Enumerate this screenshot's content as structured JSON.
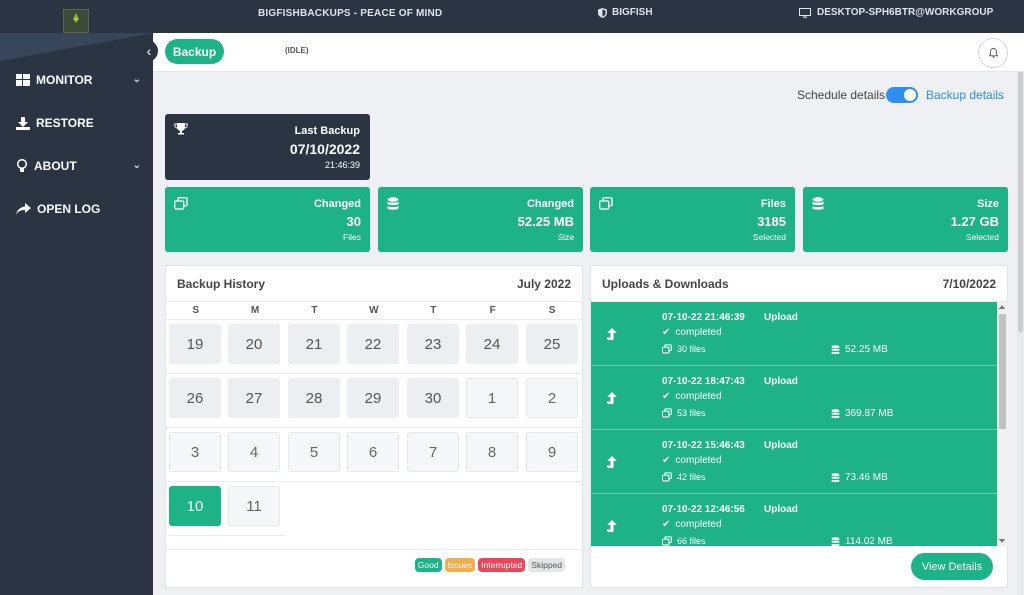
{
  "topbar": {
    "logo_text": "BigFish",
    "app_title": "BIGFISHBACKUPS - PEACE OF MIND",
    "org": "BIGFISH",
    "machine": "DESKTOP-SPH6BTR@WORKGROUP"
  },
  "sidebar": {
    "items": [
      {
        "label": "MONITOR",
        "icon": "dashboard-icon",
        "has_chevron": true
      },
      {
        "label": "RESTORE",
        "icon": "download-icon",
        "has_chevron": false
      },
      {
        "label": "ABOUT",
        "icon": "lightbulb-icon",
        "has_chevron": true
      },
      {
        "label": "OPEN LOG",
        "icon": "share-arrow-icon",
        "has_chevron": false
      }
    ]
  },
  "header": {
    "backup_label": "Backup",
    "status": "(IDLE)"
  },
  "view_toggle": {
    "left_label": "Schedule details",
    "right_label": "Backup details",
    "checked": true
  },
  "last_backup": {
    "label": "Last Backup",
    "date": "07/10/2022",
    "time": "21:46:39"
  },
  "stats": [
    {
      "label": "Changed",
      "value": "30",
      "sub": "Files",
      "icon": "copy-icon"
    },
    {
      "label": "Changed",
      "value": "52.25 MB",
      "sub": "Size",
      "icon": "database-icon"
    },
    {
      "label": "Files",
      "value": "3185",
      "sub": "Selected",
      "icon": "copy-icon"
    },
    {
      "label": "Size",
      "value": "1.27 GB",
      "sub": "Selected",
      "icon": "database-icon"
    }
  ],
  "history": {
    "title": "Backup History",
    "month": "July 2022",
    "weekdays": [
      "S",
      "M",
      "T",
      "W",
      "T",
      "F",
      "S"
    ],
    "weeks": [
      [
        "19",
        "20",
        "21",
        "22",
        "23",
        "24",
        "25"
      ],
      [
        "26",
        "27",
        "28",
        "29",
        "30",
        "1",
        "2"
      ],
      [
        "3",
        "4",
        "5",
        "6",
        "7",
        "8",
        "9"
      ],
      [
        "10",
        "11"
      ]
    ],
    "legend": [
      {
        "label": "Good",
        "color": "#1eb287"
      },
      {
        "label": "Issues",
        "color": "#f0ad4e"
      },
      {
        "label": "Interrupted",
        "color": "#e9475b"
      },
      {
        "label": "Skipped",
        "color": "#e3e5e8"
      }
    ]
  },
  "uploads": {
    "title": "Uploads & Downloads",
    "date": "7/10/2022",
    "items": [
      {
        "datetime": "07-10-22 21:46:39",
        "type": "Upload",
        "status": "completed",
        "files": "30 files",
        "size": "52.25 MB"
      },
      {
        "datetime": "07-10-22 18:47:43",
        "type": "Upload",
        "status": "completed",
        "files": "53 files",
        "size": "369.87 MB"
      },
      {
        "datetime": "07-10-22 15:46:43",
        "type": "Upload",
        "status": "completed",
        "files": "42 files",
        "size": "73.46 MB"
      },
      {
        "datetime": "07-10-22 12:46:56",
        "type": "Upload",
        "status": "completed",
        "files": "66 files",
        "size": "114.02 MB"
      }
    ],
    "view_details_label": "View Details"
  },
  "colors": {
    "accent": "#1eb287",
    "navy": "#2a3443",
    "link": "#2f8ff0"
  }
}
